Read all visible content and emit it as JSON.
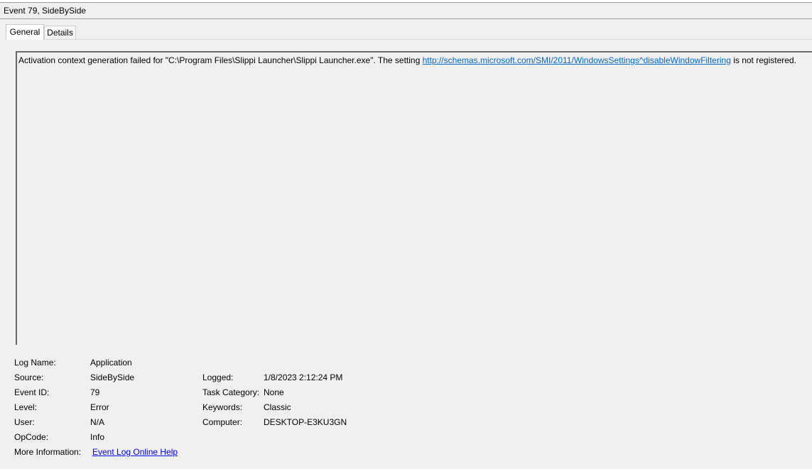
{
  "window": {
    "title": "Event 79, SideBySide"
  },
  "tabs": [
    {
      "label": "General",
      "active": true
    },
    {
      "label": "Details",
      "active": false
    }
  ],
  "description": {
    "prefix": "Activation context generation failed for \"C:\\Program Files\\Slippi Launcher\\Slippi Launcher.exe\". The setting ",
    "link": "http://schemas.microsoft.com/SMI/2011/WindowsSettings^disableWindowFiltering",
    "suffix": " is not registered."
  },
  "properties": {
    "log_name": {
      "label": "Log Name:",
      "value": "Application"
    },
    "source": {
      "label": "Source:",
      "value": "SideBySide"
    },
    "event_id": {
      "label": "Event ID:",
      "value": "79"
    },
    "level": {
      "label": "Level:",
      "value": "Error"
    },
    "user": {
      "label": "User:",
      "value": "N/A"
    },
    "opcode": {
      "label": "OpCode:",
      "value": "Info"
    },
    "more_info": {
      "label": "More Information:",
      "value": "Event Log Online Help"
    },
    "logged": {
      "label": "Logged:",
      "value": "1/8/2023 2:12:24 PM"
    },
    "task_category": {
      "label": "Task Category:",
      "value": "None"
    },
    "keywords": {
      "label": "Keywords:",
      "value": "Classic"
    },
    "computer": {
      "label": "Computer:",
      "value": "DESKTOP-E3KU3GN"
    }
  }
}
